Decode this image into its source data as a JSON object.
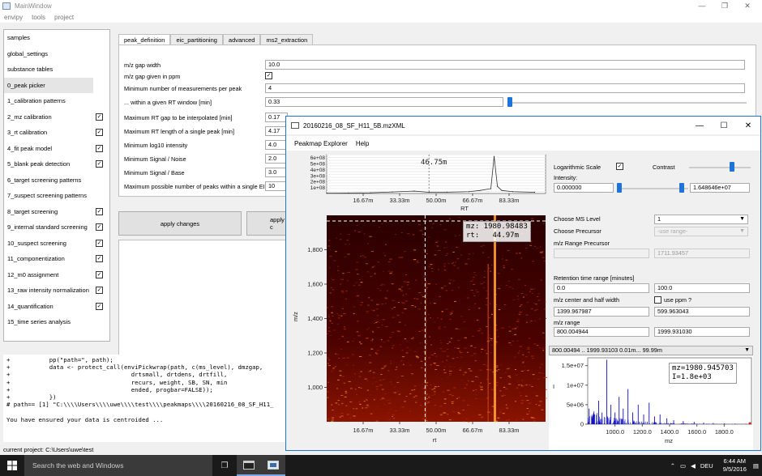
{
  "main_window": {
    "title": "MainWindow",
    "menu": [
      "envipy",
      "tools",
      "project"
    ],
    "controls": {
      "minimize": "—",
      "maximize": "❐",
      "close": "✕"
    }
  },
  "sidebar": {
    "items": [
      {
        "label": "samples",
        "checkbox": false,
        "selected": false
      },
      {
        "label": "global_settings",
        "checkbox": false,
        "selected": false
      },
      {
        "label": "substance tables",
        "checkbox": false,
        "selected": false
      },
      {
        "label": "0_peak picker",
        "checkbox": false,
        "selected": true
      },
      {
        "label": "1_calibration patterns",
        "checkbox": false,
        "selected": false
      },
      {
        "label": "2_mz calibration",
        "checkbox": true,
        "checked": true,
        "selected": false
      },
      {
        "label": "3_rt calibration",
        "checkbox": true,
        "checked": true,
        "selected": false
      },
      {
        "label": "4_fit peak model",
        "checkbox": true,
        "checked": true,
        "selected": false
      },
      {
        "label": "5_blank peak detection",
        "checkbox": true,
        "checked": true,
        "selected": false
      },
      {
        "label": "6_target screening patterns",
        "checkbox": false,
        "selected": false
      },
      {
        "label": "7_suspect screening patterns",
        "checkbox": false,
        "selected": false
      },
      {
        "label": "8_target screening",
        "checkbox": true,
        "checked": true,
        "selected": false
      },
      {
        "label": "9_internal standard screening",
        "checkbox": true,
        "checked": true,
        "selected": false
      },
      {
        "label": "10_suspect screening",
        "checkbox": true,
        "checked": true,
        "selected": false
      },
      {
        "label": "11_componentization",
        "checkbox": true,
        "checked": true,
        "selected": false
      },
      {
        "label": "12_m0 assignment",
        "checkbox": true,
        "checked": true,
        "selected": false
      },
      {
        "label": "13_raw intensity normalization",
        "checkbox": true,
        "checked": true,
        "selected": false
      },
      {
        "label": "14_quantification",
        "checkbox": true,
        "checked": true,
        "selected": false
      },
      {
        "label": "15_time series analysis",
        "checkbox": false,
        "selected": false
      }
    ]
  },
  "tabs": [
    "peak_definition",
    "eic_partitioning",
    "advanced",
    "ms2_extraction"
  ],
  "peak_definition": {
    "mz_gap_width": {
      "label": "m/z gap width",
      "value": "10.0"
    },
    "mz_gap_ppm": {
      "label": "m/z gap given in ppm",
      "checked": true
    },
    "min_measurements": {
      "label": "Minimum number of measurements per peak",
      "value": "4"
    },
    "rt_window": {
      "label": "... within a given RT window [min]",
      "value": "0.33"
    },
    "max_rt_gap": {
      "label": "Maximum RT gap to be interpolated [min]",
      "value": "0.17"
    },
    "max_rt_length": {
      "label": "Maximum RT length of a single peak [min]",
      "value": "4.17"
    },
    "min_log10_intensity": {
      "label": "Minimum log10 intensity",
      "value": "4.0"
    },
    "min_signal_noise": {
      "label": "Minimum Signal / Noise",
      "value": "2.0"
    },
    "min_signal_base": {
      "label": "Minimum Signal / Base",
      "value": "3.0"
    },
    "max_peaks_eic": {
      "label": "Maximum possible number of peaks within a single EIC",
      "value": "10"
    }
  },
  "buttons": {
    "apply_changes": "apply changes",
    "apply_cut": "apply c"
  },
  "console": {
    "lines": [
      "+           pp(\"path=\", path);",
      "+           data <- protect_call(enviPickwrap(path, c(ms_level), dmzgap,",
      "+                                  drtsmall, drtdens, drtfill,",
      "+                                  recurs, weight, SB, SN, min",
      "+                                  ended, progbar=FALSE));",
      "+           })",
      "# path== [1] \"C:\\\\\\\\Users\\\\\\\\uwe\\\\\\\\test\\\\\\\\peakmaps\\\\\\\\20160216_08_SF_H11_",
      "",
      "You have ensured your data is centroided ..."
    ]
  },
  "status": "current project: C:\\Users\\uwe\\test",
  "peakmap": {
    "title": "20160216_08_SF_H11_5B.mzXML",
    "menu": [
      "Peakmap Explorer",
      "Help"
    ],
    "controls": {
      "minimize": "—",
      "maximize": "☐",
      "close": "✕"
    },
    "tic": {
      "marker_label": "46.75m",
      "y_ticks": [
        "6e+08",
        "5e+08",
        "4e+08",
        "3e+08",
        "2e+08",
        "1e+08"
      ],
      "x_ticks": [
        "16.67m",
        "33.33m",
        "50.00m",
        "66.67m",
        "83.33m"
      ],
      "x_label": "RT"
    },
    "heatmap": {
      "overlay": "mz: 1980.98483\nrt:   44.97m",
      "y_ticks": [
        "1,800",
        "1,600",
        "1,400",
        "1,200",
        "1,000"
      ],
      "x_ticks": [
        "16.67m",
        "33.33m",
        "50.00m",
        "66.67m",
        "83.33m"
      ],
      "x_label": "rt",
      "y_label": "m/z"
    },
    "controls_panel": {
      "log_scale_label": "Logarithmic Scale",
      "log_scale_checked": true,
      "contrast_label": "Contrast",
      "intensity_label": "Intensity:",
      "intensity_min": "0.000000",
      "intensity_max": "1.648646e+07",
      "ms_level_label": "Choose MS Level",
      "ms_level_value": "1",
      "precursor_label": "Choose Precursor",
      "precursor_value": "-use range-",
      "mz_range_precursor_label": "m/z Range Precursor",
      "mz_range_precursor_to": "1711.93457",
      "rt_range_label": "Retention time range [minutes]",
      "rt_min": "0.0",
      "rt_max": "100.0",
      "mz_center_label": "m/z center and half width",
      "use_ppm_label": "use ppm ?",
      "mz_center": "1399.967987",
      "mz_half_width": "599.963043",
      "mz_range_label": "m/z range",
      "mz_range_min": "800.004944",
      "mz_range_max": "1999.931030",
      "spectrum_selector": "800.00494 .. 1999.93103  0.01m... 99.99m"
    },
    "spectrum": {
      "overlay": "mz=1980.945703\nI=1.8e+03",
      "y_ticks": [
        "1.5e+07",
        "1e+07",
        "5e+06",
        "0"
      ],
      "x_ticks": [
        "1000.0",
        "1200.0",
        "1400.0",
        "1600.0",
        "1800.0"
      ],
      "x_label": "mz",
      "y_label": "I"
    }
  },
  "taskbar": {
    "search_placeholder": "Search the web and Windows",
    "language": "DEU",
    "time": "6:44 AM",
    "date": "9/5/2016"
  },
  "chart_data": [
    {
      "type": "line",
      "title": "",
      "xlabel": "RT",
      "ylabel": "",
      "x_ticks": [
        "16.67m",
        "33.33m",
        "50.00m",
        "66.67m",
        "83.33m"
      ],
      "y_ticks": [
        "1e+08",
        "2e+08",
        "3e+08",
        "4e+08",
        "5e+08",
        "6e+08"
      ],
      "x": [
        0,
        10,
        20,
        30,
        40,
        46.75,
        55,
        65,
        70,
        75,
        76.5,
        78,
        80,
        85,
        95
      ],
      "values": [
        5000000.0,
        8000000.0,
        12000000.0,
        25000000.0,
        40000000.0,
        20000000.0,
        22000000.0,
        30000000.0,
        50000000.0,
        80000000.0,
        620000000.0,
        120000000.0,
        50000000.0,
        30000000.0,
        20000000.0
      ],
      "ylim": [
        0,
        650000000.0
      ]
    },
    {
      "type": "heatmap",
      "xlabel": "rt",
      "ylabel": "m/z",
      "x_ticks": [
        "16.67m",
        "33.33m",
        "50.00m",
        "66.67m",
        "83.33m"
      ],
      "y_ticks": [
        "1,000",
        "1,200",
        "1,400",
        "1,600",
        "1,800"
      ],
      "xlim": [
        0,
        100
      ],
      "ylim": [
        800,
        2000
      ],
      "cursor": {
        "rt": 44.97,
        "mz": 1980.98483
      }
    },
    {
      "type": "bar",
      "xlabel": "mz",
      "ylabel": "I",
      "x_ticks": [
        "1000.0",
        "1200.0",
        "1400.0",
        "1600.0",
        "1800.0"
      ],
      "y_ticks": [
        "0",
        "5e+06",
        "1e+07",
        "1.5e+07"
      ],
      "xlim": [
        800,
        2000
      ],
      "ylim": [
        0,
        17000000.0
      ],
      "x": [
        810,
        850,
        880,
        905,
        940,
        970,
        1000,
        1030,
        1060,
        1095,
        1130,
        1170,
        1210,
        1250,
        1290,
        1330,
        1380,
        1430,
        1500,
        1580,
        1650,
        1720,
        1800,
        1880,
        1960
      ],
      "values": [
        4000000.0,
        2500000.0,
        6000000.0,
        3000000.0,
        16500000.0,
        5000000.0,
        3000000.0,
        7000000.0,
        4000000.0,
        9000000.0,
        3000000.0,
        5000000.0,
        2500000.0,
        5500000.0,
        2000000.0,
        2500000.0,
        1500000.0,
        1000000.0,
        800000.0,
        600000.0,
        400000.0,
        300000.0,
        200000.0,
        150000.0,
        100000.0
      ]
    }
  ]
}
